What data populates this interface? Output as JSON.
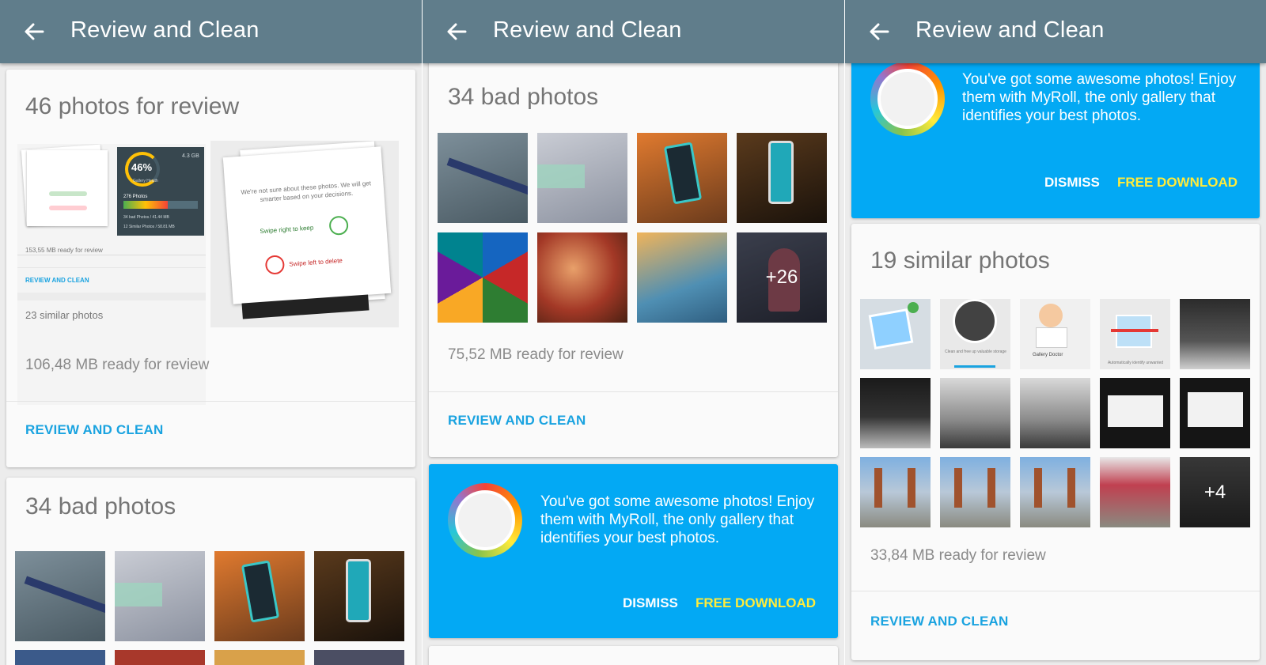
{
  "app_title": "Review and Clean",
  "screen1": {
    "review_card": {
      "title": "46 photos for review",
      "ready": "106,48 MB ready for review",
      "action": "REVIEW AND CLEAN",
      "illustration": {
        "left_ready": "153,55 MB ready for review",
        "left_link": "REVIEW AND CLEAN",
        "left_similar": "23 similar photos",
        "gauge_pct": "46%",
        "gauge_storage": "4.3 GB",
        "gauge_caption": "Gallery Health",
        "list_header": "276 Photos",
        "list_item_1": "34 bad Photos / 41.44 MB",
        "list_item_2": "12 Similar Photos / 58.81 MB",
        "big_text": "We're not sure about these photos. We will get smarter based on your decisions.",
        "keep": "Swipe right to keep",
        "delete": "Swipe left to delete"
      }
    },
    "bad_card": {
      "title": "34 bad photos"
    }
  },
  "screen2": {
    "bad_card": {
      "title": "34 bad photos",
      "more_count": "+26",
      "ready": "75,52 MB ready for review",
      "action": "REVIEW AND CLEAN"
    },
    "promo": {
      "message": "You've got some awesome photos! Enjoy them with MyRoll, the only gallery that identifies your best photos.",
      "dismiss": "DISMISS",
      "download": "FREE DOWNLOAD"
    }
  },
  "screen3": {
    "promo": {
      "message": "You've got some awesome photos! Enjoy them with MyRoll, the only gallery that identifies your best photos.",
      "dismiss": "DISMISS",
      "download": "FREE DOWNLOAD"
    },
    "similar_card": {
      "title": "19 similar photos",
      "more_count": "+4",
      "ready": "33,84 MB ready for review",
      "action": "REVIEW AND CLEAN",
      "thumb_labels": {
        "clean": "Clean and free up valuable storage",
        "doctor": "Gallery Doctor",
        "auto": "Automatically identify unwanted"
      }
    }
  },
  "colors": {
    "appbar": "#607d8b",
    "accent": "#1aa3e0",
    "promo": "#03a9f4",
    "download": "#ffeb3b"
  },
  "icons": {
    "back": "arrow-left-icon",
    "myroll": "myroll-logo-icon"
  }
}
